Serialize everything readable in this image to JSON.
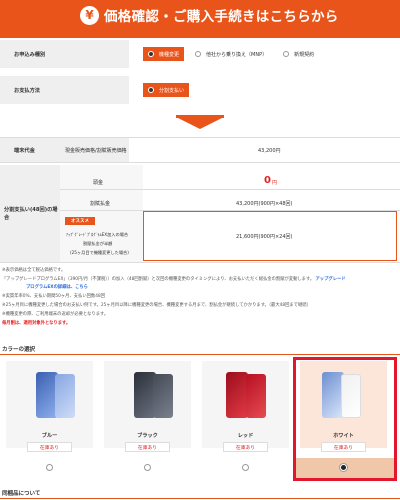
{
  "header": {
    "icon": "yen-circle-icon",
    "yen": "¥",
    "title": "価格確認・ご購入手続きはこちらから"
  },
  "application": {
    "label": "お申込み種別",
    "options": [
      {
        "label": "機種変更",
        "selected": true
      },
      {
        "label": "他社から乗り換え（MNP）",
        "selected": false
      },
      {
        "label": "新規契約",
        "selected": false
      }
    ]
  },
  "payment": {
    "label": "お支払方法",
    "selected_option": "分割支払い"
  },
  "price_table": {
    "device_price_label": "端末代金",
    "device_price_sublabel": "現金販売価格/割賦販売価格",
    "device_price_value": "43,200円",
    "installment_label": "分割支払い(48回)の場合",
    "down_payment_label": "頭金",
    "down_payment_value": "0",
    "down_payment_unit": "円",
    "installment_total_label": "割賦払金",
    "installment_total_value": "43,200円(900円×48回)",
    "recommend_badge": "オススメ",
    "upgrade_label_1": "ｱｯﾌﾟｸﾞﾚｰﾄﾞﾌﾟﾛｸﾞﾗﾑEX加入の場合",
    "upgrade_label_2": "割賦払金が半額",
    "upgrade_label_3": "(25ヶ月目で機種変更した場合)",
    "upgrade_value": "21,600円(900円×24回)"
  },
  "notes": {
    "line1": "※表示価格は全て税込価格です。",
    "line2a": "「アップグレードプログラムEX」（390円/月（不課税））の加入（48回割賦）と次回の機種変更のタイミングにより、お支払いただく総払金の割賦が変動します。",
    "line2_link1": "アップグレード",
    "line3_link2": "プログラムEXの詳細は、こちら",
    "line4": "※実質年率0%、支払い期間50ヶ月、支払い回数48回",
    "line5": "※25ヶ月目に機種変更した場合のお支払い例です。25ヶ月目以降に機種変更の場合、機種変更する月まで、割払金が継続してかかります。（最大48回まで継続）",
    "line6": "※機種変更の際、ご利用端末の返却が必要となります。",
    "line7": "毎月割は、適用対象外となります。"
  },
  "color_section": {
    "title": "カラーの選択",
    "colors": [
      {
        "name": "ブルー",
        "stock": "在庫あり",
        "selected": false,
        "swatch": "#6a8fd8"
      },
      {
        "name": "ブラック",
        "stock": "在庫あり",
        "selected": false,
        "swatch": "#2c2f35"
      },
      {
        "name": "レッド",
        "stock": "在庫あり",
        "selected": false,
        "swatch": "#c8102e"
      },
      {
        "name": "ホワイト",
        "stock": "在庫あり",
        "selected": true,
        "swatch": "#f4f4f4"
      }
    ]
  },
  "bundled_section": {
    "title": "同梱品について"
  },
  "colors": {
    "accent": "#e8541a",
    "alert_red": "#e81f1f",
    "selection_frame": "#e2162c",
    "link_blue": "#2a6bd8"
  }
}
